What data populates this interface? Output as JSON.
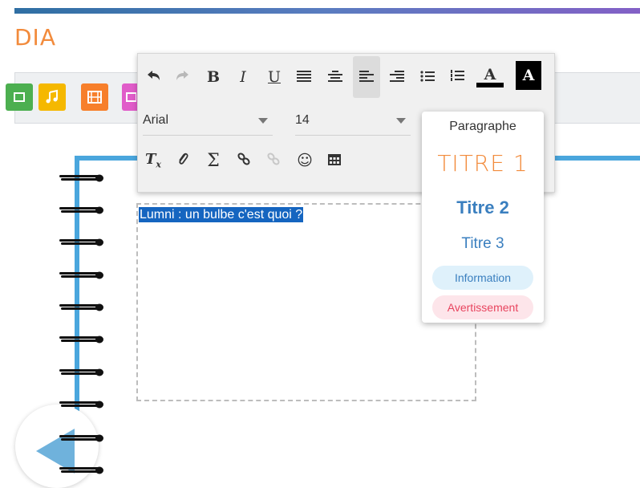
{
  "app": {
    "title": "DIA"
  },
  "media_toolbar": {
    "buttons": [
      {
        "name": "media-video-button",
        "icon": "video-icon",
        "color": "#4caf50"
      },
      {
        "name": "media-music-button",
        "icon": "music-note-icon",
        "color": "#f5b800"
      },
      {
        "name": "media-film-button",
        "icon": "film-icon",
        "color": "#f77f2b"
      },
      {
        "name": "media-image-button",
        "icon": "image-icon",
        "color": "#e05cc9"
      }
    ]
  },
  "editor": {
    "toolbar_row1": {
      "undo": "undo-icon",
      "redo": "redo-icon",
      "bold": "B",
      "italic": "I",
      "underline": "U",
      "justify": "align-justify-icon",
      "center": "align-center-icon",
      "left": "align-left-icon",
      "right": "align-right-icon",
      "bullets": "bullet-list-icon",
      "numbered": "numbered-list-icon",
      "text_color_letter": "A",
      "bg_color_letter": "A"
    },
    "font_select": {
      "value": "Arial"
    },
    "size_select": {
      "value": "14"
    },
    "toolbar_row3": {
      "clear_format": "clear-format-icon",
      "attach": "paperclip-icon",
      "sum": "Σ",
      "link": "link-icon",
      "unlink": "unlink-icon",
      "emoji": "☺",
      "table": "table-icon"
    }
  },
  "format_menu": {
    "paragraph": "Paragraphe",
    "title1": "TITRE 1",
    "title2": "Titre 2",
    "title3": "Titre 3",
    "info": "Information",
    "warning": "Avertissement",
    "colors": {
      "title1": "#f28b3c",
      "title": "#3a7fbf",
      "info_bg": "#dff1fb",
      "warning_bg": "#fde5ea",
      "warning_text": "#e8455f"
    }
  },
  "notebook": {
    "selected_text": "Lumni : un bulbe c'est quoi ?"
  }
}
